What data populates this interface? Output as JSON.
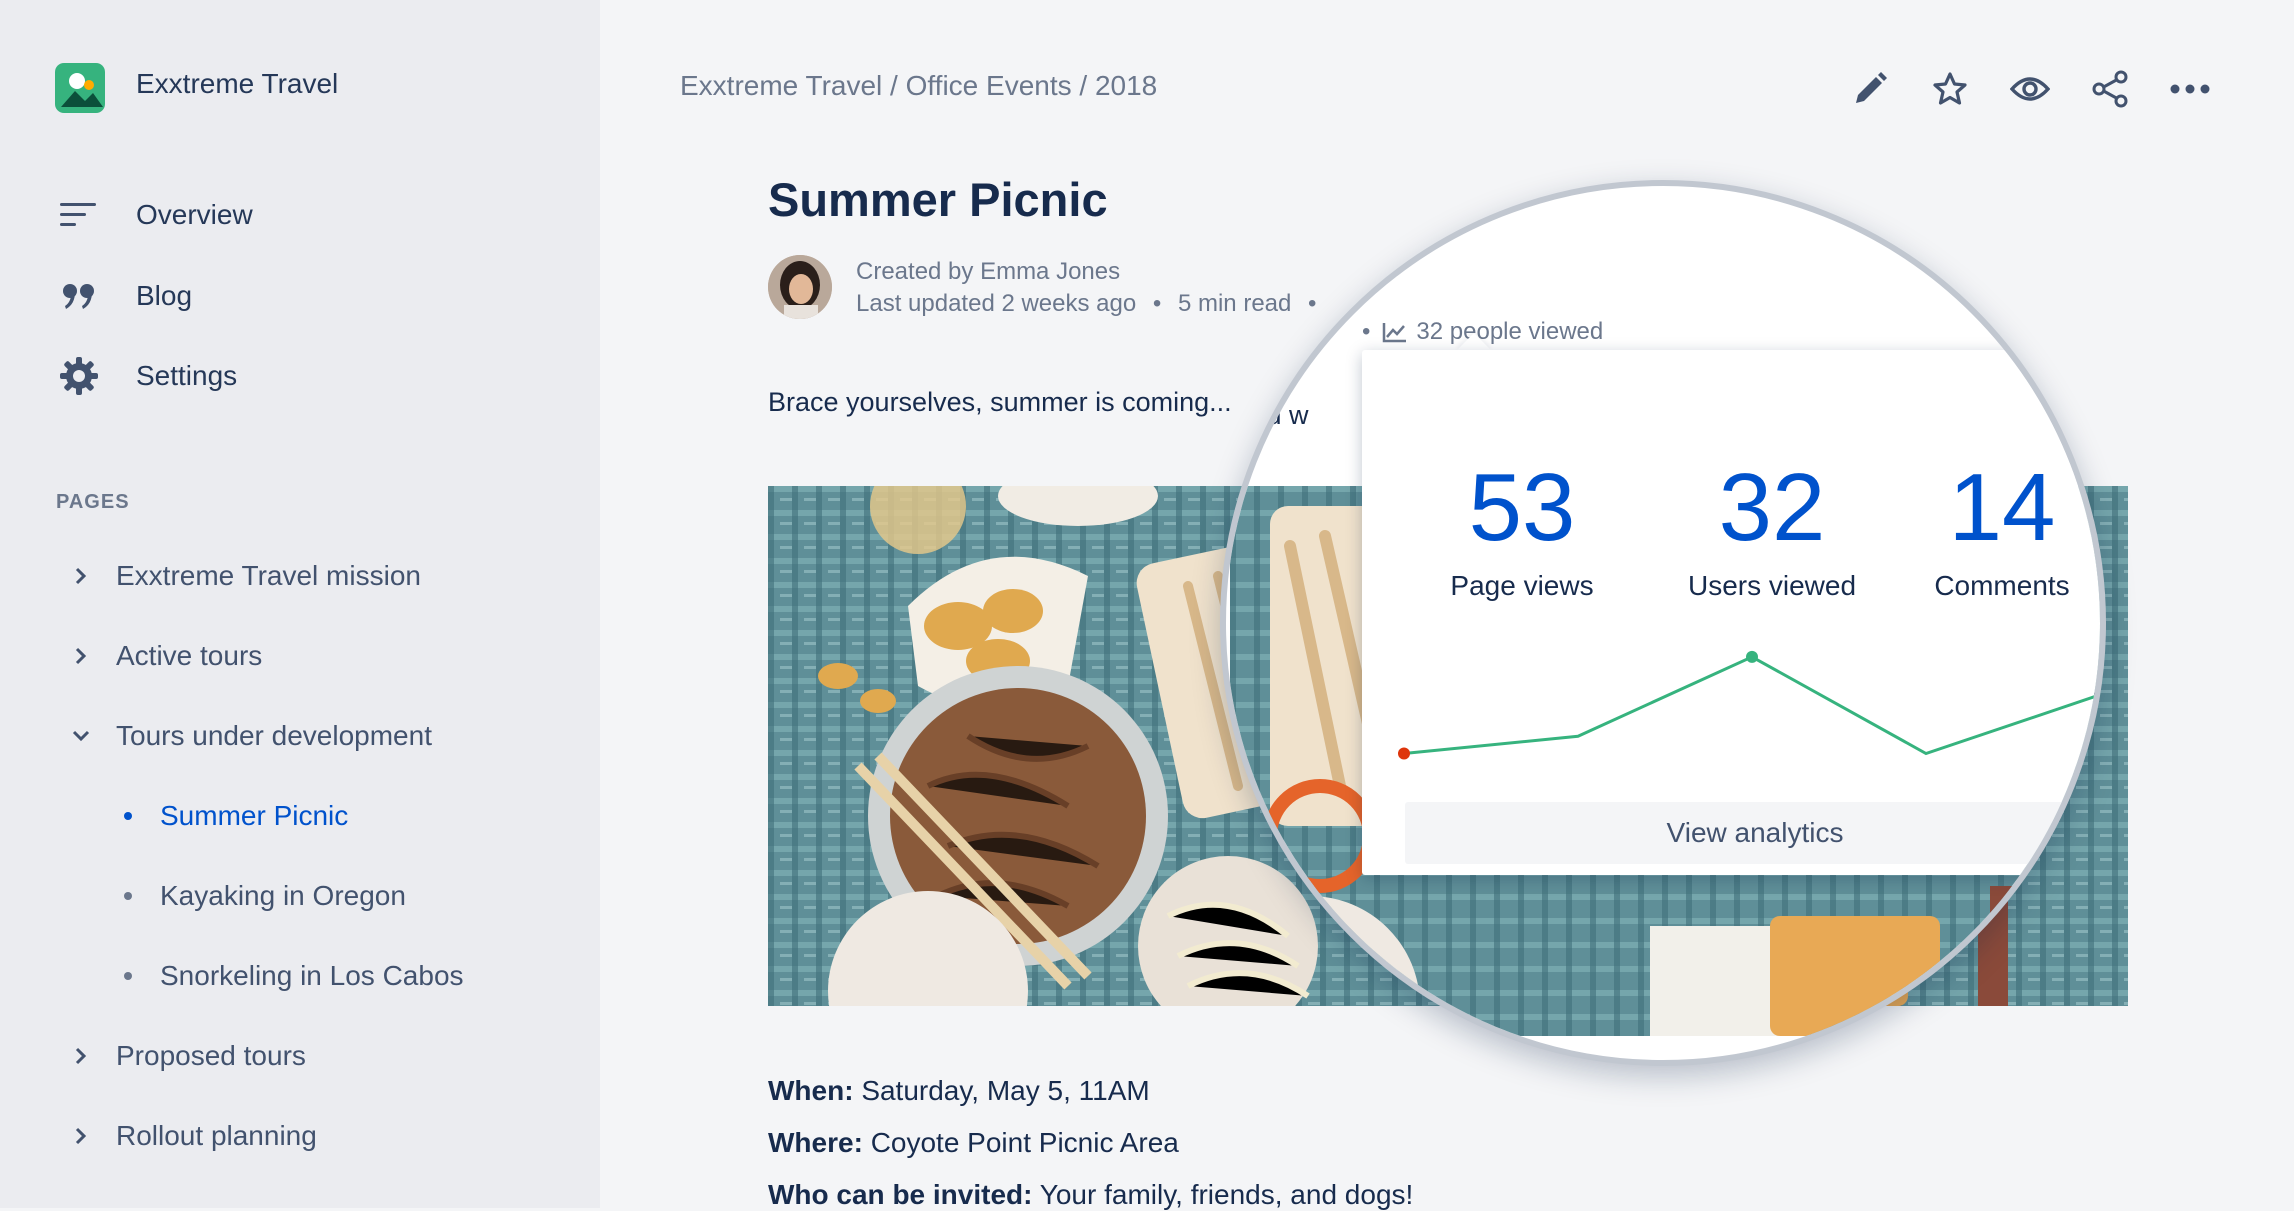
{
  "sidebar": {
    "app_title": "Exxtreme Travel",
    "nav": [
      {
        "label": "Overview",
        "icon": "overview-lines-icon"
      },
      {
        "label": "Blog",
        "icon": "quote-icon"
      },
      {
        "label": "Settings",
        "icon": "gear-icon"
      }
    ],
    "pages_heading": "PAGES",
    "tree": [
      {
        "label": "Exxtreme Travel mission",
        "state": "collapsed"
      },
      {
        "label": "Active tours",
        "state": "collapsed"
      },
      {
        "label": "Tours under development",
        "state": "expanded"
      },
      {
        "label": "Summer Picnic",
        "state": "child-active"
      },
      {
        "label": "Kayaking in Oregon",
        "state": "child"
      },
      {
        "label": "Snorkeling in Los Cabos",
        "state": "child"
      },
      {
        "label": "Proposed tours",
        "state": "collapsed"
      },
      {
        "label": "Rollout planning",
        "state": "collapsed"
      }
    ]
  },
  "header": {
    "breadcrumb": "Exxtreme Travel / Office Events / 2018",
    "toolbar": [
      "edit-pencil-icon",
      "star-icon",
      "watch-eye-icon",
      "share-icon",
      "more-dots-icon"
    ]
  },
  "page": {
    "title": "Summer Picnic",
    "created_by": "Created by Emma Jones",
    "last_updated": "Last updated 2 weeks ago",
    "read_time": "5 min read",
    "people_viewed": "32 people viewed",
    "intro": "Brace yourselves, summer is coming...",
    "intro_fragment": ". And w",
    "details": [
      {
        "label": "When:",
        "value": "Saturday, May 5, 11AM"
      },
      {
        "label": "Where:",
        "value": "Coyote Point Picnic Area"
      },
      {
        "label": "Who can be invited:",
        "value": "Your family, friends, and dogs!"
      }
    ]
  },
  "analytics": {
    "stats": [
      {
        "value": "53",
        "label": "Page views"
      },
      {
        "value": "32",
        "label": "Users viewed"
      },
      {
        "value": "14",
        "label": "Comments"
      }
    ],
    "button": "View analytics",
    "colors": {
      "line": "#36b37e",
      "start_point": "#de350b",
      "peak_point": "#36b37e",
      "end_point": "#172b4d",
      "accent": "#0052cc"
    }
  },
  "chart_data": {
    "type": "line",
    "series": [
      {
        "values": [
          10,
          15,
          38,
          10,
          27
        ]
      }
    ],
    "ylim": [
      0,
      40
    ],
    "grid": false
  }
}
